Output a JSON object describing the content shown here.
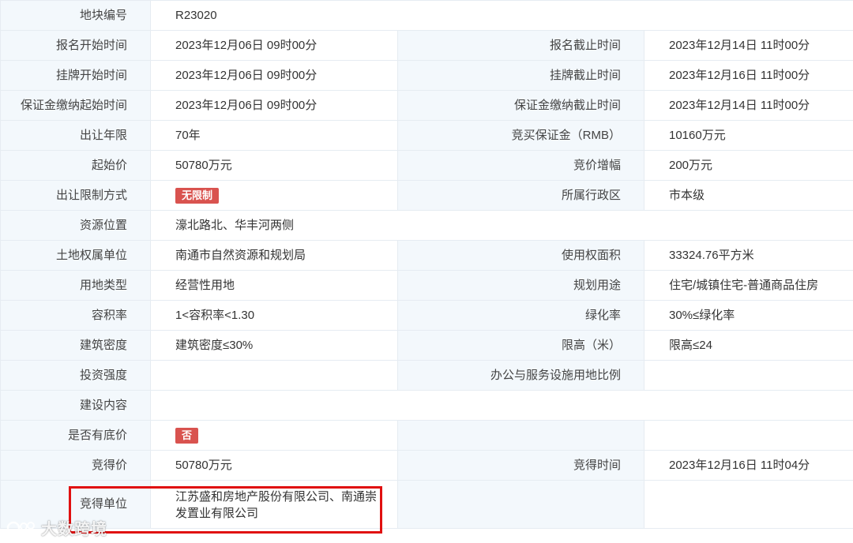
{
  "rows": {
    "r0": {
      "l1": "地块编号",
      "v1": "R23020"
    },
    "r1": {
      "l1": "报名开始时间",
      "v1": "2023年12月06日 09时00分",
      "l2": "报名截止时间",
      "v2": "2023年12月14日 11时00分"
    },
    "r2": {
      "l1": "挂牌开始时间",
      "v1": "2023年12月06日 09时00分",
      "l2": "挂牌截止时间",
      "v2": "2023年12月16日 11时00分"
    },
    "r3": {
      "l1": "保证金缴纳起始时间",
      "v1": "2023年12月06日 09时00分",
      "l2": "保证金缴纳截止时间",
      "v2": "2023年12月14日 11时00分"
    },
    "r4": {
      "l1": "出让年限",
      "v1": "70年",
      "l2": "竞买保证金（RMB）",
      "v2": "10160万元"
    },
    "r5": {
      "l1": "起始价",
      "v1": "50780万元",
      "l2": "竞价增幅",
      "v2": "200万元"
    },
    "r6": {
      "l1": "出让限制方式",
      "v1": "无限制",
      "l2": "所属行政区",
      "v2": "市本级"
    },
    "r7": {
      "l1": "资源位置",
      "v1": "濠北路北、华丰河两侧"
    },
    "r8": {
      "l1": "土地权属单位",
      "v1": "南通市自然资源和规划局",
      "l2": "使用权面积",
      "v2": "33324.76平方米"
    },
    "r9": {
      "l1": "用地类型",
      "v1": "经营性用地",
      "l2": "规划用途",
      "v2": "住宅/城镇住宅-普通商品住房"
    },
    "r10": {
      "l1": "容积率",
      "v1": "1<容积率<1.30",
      "l2": "绿化率",
      "v2": "30%≤绿化率"
    },
    "r11": {
      "l1": "建筑密度",
      "v1": "建筑密度≤30%",
      "l2": "限高（米）",
      "v2": "限高≤24"
    },
    "r12": {
      "l1": "投资强度",
      "v1": "",
      "l2": "办公与服务设施用地比例",
      "v2": ""
    },
    "r13": {
      "l1": "建设内容",
      "v1": ""
    },
    "r14": {
      "l1": "是否有底价",
      "v1": "否"
    },
    "r15": {
      "l1": "竞得价",
      "v1": "50780万元",
      "l2": "竞得时间",
      "v2": "2023年12月16日 11时04分"
    },
    "r16": {
      "l1": "竞得单位",
      "v1_line1": "江苏盛和房地产股份有限公司、南通崇",
      "v1_line2": "发置业有限公司"
    }
  },
  "colors": {
    "label_bg": "#f3f8fc",
    "border": "#e6ecf2",
    "badge": "#d9534f",
    "highlight": "#e01010"
  },
  "watermark": {
    "text": "大数跨境"
  }
}
